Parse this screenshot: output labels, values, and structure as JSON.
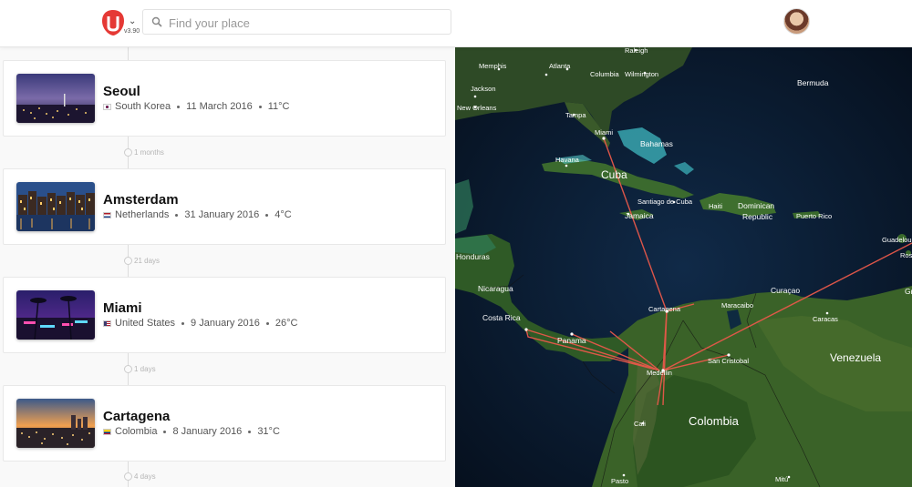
{
  "header": {
    "version": "v3.90",
    "search_placeholder": "Find your place"
  },
  "timeline": [
    {
      "city": "Seoul",
      "country": "South Korea",
      "date": "11 March 2016",
      "temp": "11°C",
      "flag": [
        "#ffffff",
        "#c60c30",
        "#003478"
      ]
    },
    {
      "city": "Amsterdam",
      "country": "Netherlands",
      "date": "31 January 2016",
      "temp": "4°C",
      "flag": [
        "#ae1c28",
        "#ffffff",
        "#21468b"
      ]
    },
    {
      "city": "Miami",
      "country": "United States",
      "date": "9 January 2016",
      "temp": "26°C",
      "flag": [
        "#b22234",
        "#ffffff",
        "#3c3b6e"
      ]
    },
    {
      "city": "Cartagena",
      "country": "Colombia",
      "date": "8 January 2016",
      "temp": "31°C",
      "flag": [
        "#fcd116",
        "#003893",
        "#ce1126"
      ]
    }
  ],
  "gaps": [
    "1 months",
    "21 days",
    "1 days",
    "4 days"
  ],
  "map": {
    "labels": {
      "memphis": "Memphis",
      "atlanta": "Atlanta",
      "raleigh": "Raleigh",
      "columbia": "Columbia",
      "wilmington": "Wilmington",
      "bermuda": "Bermuda",
      "jackson": "Jackson",
      "new_orleans": "New Orleans",
      "tampa": "Tampa",
      "miami": "Miami",
      "bahamas": "Bahamas",
      "havana": "Havana",
      "cuba": "Cuba",
      "santiago": "Santiago de Cuba",
      "haiti": "Haiti",
      "dominican": "Dominican",
      "republic": "Republic",
      "puerto_rico": "Puerto Rico",
      "jamaica": "Jamaica",
      "guadeloupe": "Guadeloupe",
      "ros": "Ros",
      "honduras": "Honduras",
      "gr": "Gr",
      "nicaragua": "Nicaragua",
      "cartagena": "Cartagena",
      "maracaibo": "Maracaibo",
      "curacao": "Curaçao",
      "costa_rica": "Costa Rica",
      "panama": "Panama",
      "caracas": "Caracas",
      "venezuela": "Venezuela",
      "san_cristobal": "San Cristobal",
      "medellin": "Medellin",
      "cali": "Cali",
      "colombia": "Colombia",
      "pasto": "Pasto",
      "mitu": "Mitú"
    },
    "route_color": "#e8584a"
  }
}
